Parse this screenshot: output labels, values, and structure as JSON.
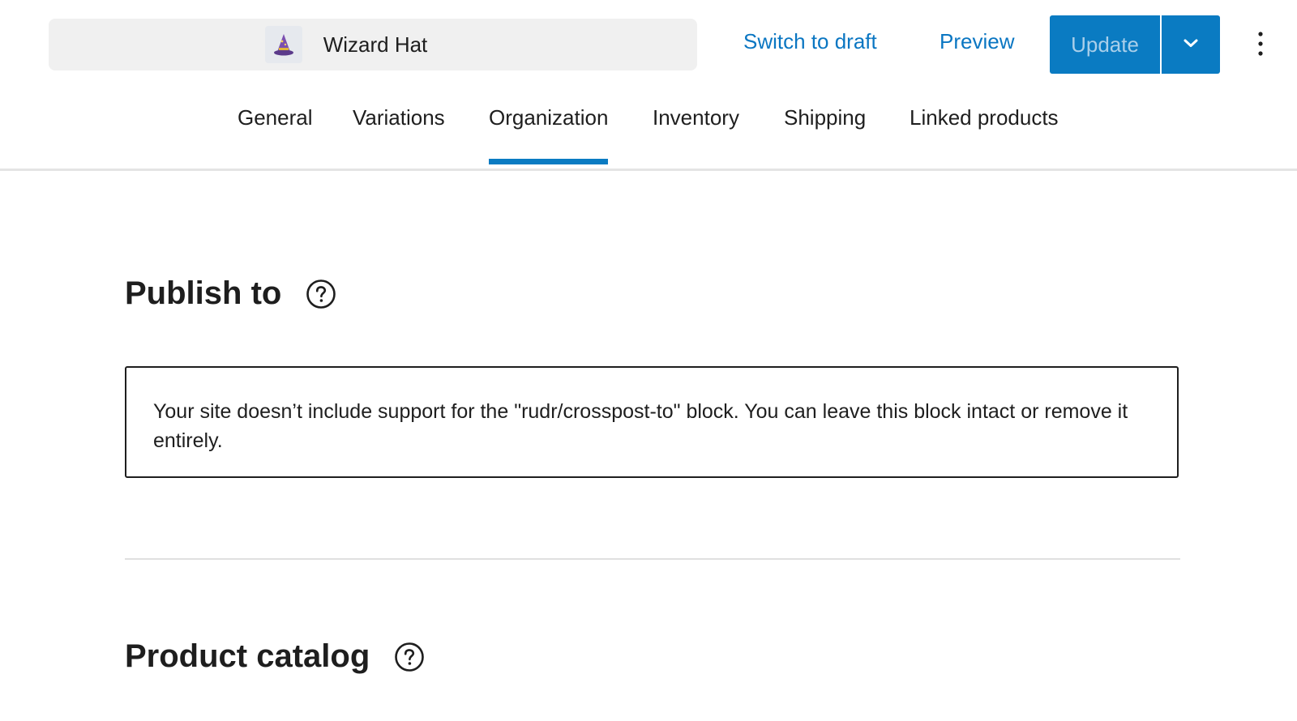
{
  "header": {
    "product_name": "Wizard Hat",
    "thumbnail_icon": "wizard-hat-icon",
    "switch_to_draft_label": "Switch to draft",
    "preview_label": "Preview",
    "update_label": "Update",
    "accent_color": "#0a7bc2",
    "link_color": "#0a76c2"
  },
  "tabs": [
    {
      "label": "General",
      "active": false
    },
    {
      "label": "Variations",
      "active": false
    },
    {
      "label": "Organization",
      "active": true
    },
    {
      "label": "Inventory",
      "active": false
    },
    {
      "label": "Shipping",
      "active": false
    },
    {
      "label": "Linked products",
      "active": false
    }
  ],
  "sections": {
    "publish_to": {
      "heading": "Publish to",
      "notice": "Your site doesn’t include support for the \"rudr/crosspost-to\" block. You can leave this block intact or remove it entirely."
    },
    "product_catalog": {
      "heading": "Product catalog"
    }
  }
}
